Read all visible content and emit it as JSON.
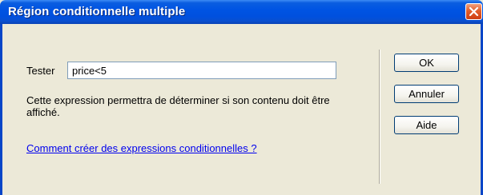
{
  "window": {
    "title": "Région conditionnelle multiple"
  },
  "form": {
    "test_label": "Tester",
    "test_value": "price<5",
    "description": "Cette expression permettra de déterminer si son contenu doit être affiché.",
    "help_link": "Comment créer des expressions conditionnelles ?"
  },
  "buttons": {
    "ok": "OK",
    "cancel": "Annuler",
    "help": "Aide"
  },
  "colors": {
    "titlebar": "#0054e3",
    "close": "#e25d2b",
    "link": "#0000ee",
    "dialog_bg": "#ece9d8"
  },
  "icons": {
    "close": "close-icon"
  }
}
